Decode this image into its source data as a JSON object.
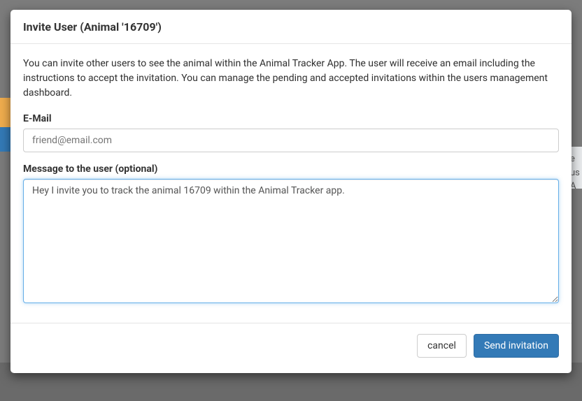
{
  "modal": {
    "title": "Invite User (Animal '16709')",
    "description": "You can invite other users to see the animal within the Animal Tracker App. The user will receive an email including the instructions to accept the invitation. You can manage the pending and accepted invitations within the users management dashboard.",
    "email": {
      "label": "E-Mail",
      "placeholder": "friend@email.com",
      "value": ""
    },
    "message": {
      "label": "Message to the user (optional)",
      "value": "Hey I invite you to track the animal 16709 within the Animal Tracker app."
    },
    "buttons": {
      "cancel": "cancel",
      "send": "Send invitation"
    }
  },
  "background": {
    "right_text": "e us\n A"
  }
}
